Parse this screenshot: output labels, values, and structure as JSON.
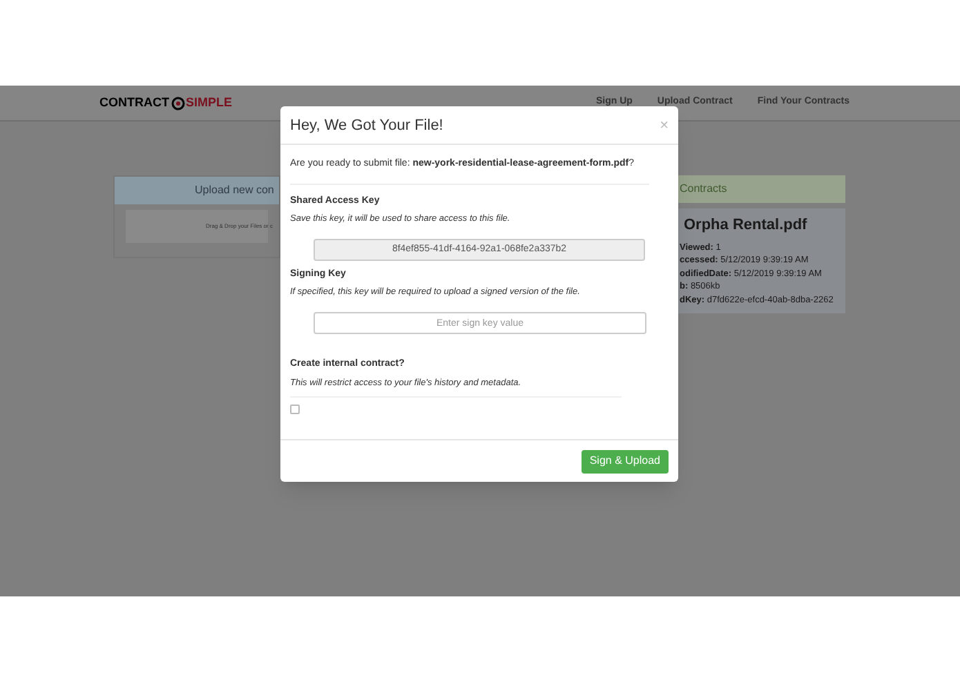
{
  "navbar": {
    "logo": {
      "left": "CONTRACT",
      "right": "SIMPLE"
    },
    "links": [
      "Sign Up",
      "Upload Contract",
      "Find Your Contracts"
    ]
  },
  "upload_panel": {
    "header": "Upload new con",
    "dropzone": "Drag & Drop your Files or c"
  },
  "contracts_panel": {
    "header": "Contracts",
    "card": {
      "title": "Orpha Rental.pdf",
      "fields": [
        {
          "label": "Viewed:",
          "value": "1"
        },
        {
          "label": "ccessed:",
          "value": "5/12/2019 9:39:19 AM"
        },
        {
          "label": "odifiedDate:",
          "value": "5/12/2019 9:39:19 AM"
        },
        {
          "label": "b:",
          "value": "8506kb"
        },
        {
          "label": "dKey:",
          "value": "d7fd622e-efcd-40ab-8dba-2262"
        }
      ]
    }
  },
  "modal": {
    "title": "Hey, We Got Your File!",
    "close": "×",
    "question": "Are you ready to submit file: **new-york-residential-lease-agreement-form.pdf**?",
    "sections": [
      {
        "kind": "readonly",
        "title": "Shared Access Key",
        "hint": "Save this key, it will be used to share access to this file.",
        "value": "8f4ef855-41df-4164-92a1-068fe2a337b2"
      },
      {
        "kind": "input",
        "title": "Signing Key",
        "hint": "If specified, this key will be required to upload a signed version of the file.",
        "placeholder": "Enter sign key value"
      },
      {
        "kind": "checkbox",
        "title": "Create internal contract?",
        "hint": "This will restrict access to your file's history and metadata.",
        "checked": false
      }
    ],
    "button": "Sign & Upload"
  }
}
